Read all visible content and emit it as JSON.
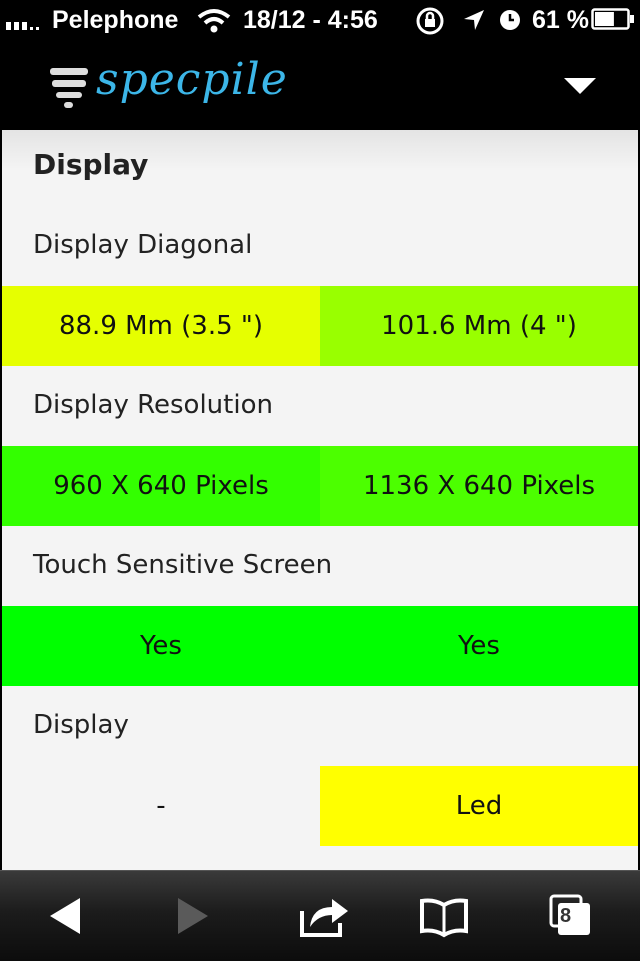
{
  "status_bar": {
    "carrier": "Pelephone",
    "datetime": "18/12 - 4:56",
    "battery": "61 %",
    "battery_level": 0.61
  },
  "header": {
    "logo": "specpile"
  },
  "section": {
    "title": "Display",
    "specs": [
      {
        "label": "Display Diagonal",
        "values": [
          "88.9 Mm (3.5 \")",
          "101.6 Mm (4 \")"
        ],
        "colors": [
          "#e6ff00",
          "#99ff00"
        ]
      },
      {
        "label": "Display Resolution",
        "values": [
          "960 X 640 Pixels",
          "1136 X 640 Pixels"
        ],
        "colors": [
          "#33ff00",
          "#4cff00"
        ]
      },
      {
        "label": "Touch Sensitive Screen",
        "values": [
          "Yes",
          "Yes"
        ],
        "colors": [
          "#00ff00",
          "#00ff00"
        ]
      },
      {
        "label": "Display",
        "values": [
          "-",
          "Led"
        ],
        "colors": [
          "#f4f4f4",
          "#ffff00"
        ]
      }
    ]
  },
  "toolbar": {
    "tabs_count": "8"
  }
}
